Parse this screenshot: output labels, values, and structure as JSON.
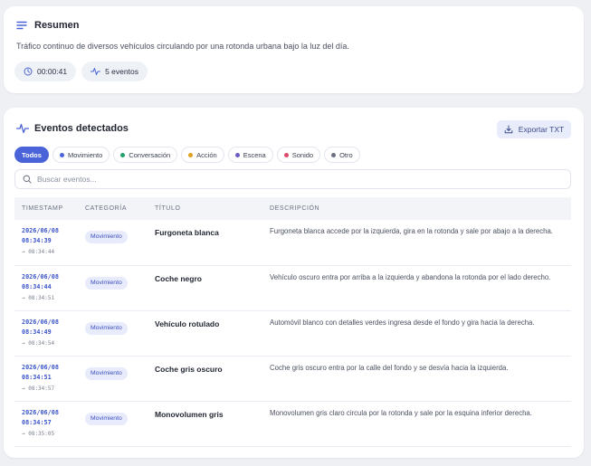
{
  "summary": {
    "title": "Resumen",
    "description": "Tráfico continuo de diversos vehículos circulando por una rotonda urbana bajo la luz del día.",
    "duration": "00:00:41",
    "events_count": "5 eventos"
  },
  "events": {
    "title": "Eventos detectados",
    "export_label": "Exportar TXT",
    "search_placeholder": "Buscar eventos...",
    "filters": [
      {
        "label": "Todos",
        "active": true,
        "color": ""
      },
      {
        "label": "Movimiento",
        "active": false,
        "color": "#4a63d8"
      },
      {
        "label": "Conversación",
        "active": false,
        "color": "#22a06b"
      },
      {
        "label": "Acción",
        "active": false,
        "color": "#e0a020"
      },
      {
        "label": "Escena",
        "active": false,
        "color": "#6a5cc8"
      },
      {
        "label": "Sonido",
        "active": false,
        "color": "#e0486a"
      },
      {
        "label": "Otro",
        "active": false,
        "color": "#6a7080"
      }
    ],
    "columns": [
      "TIMESTAMP",
      "CATEGORÍA",
      "TÍTULO",
      "DESCRIPCIÓN"
    ],
    "rows": [
      {
        "date": "2026/06/08",
        "time": "08:34:39",
        "end": "→ 08:34:44",
        "category": "Movimiento",
        "title": "Furgoneta blanca",
        "description": "Furgoneta blanca accede por la izquierda, gira en la rotonda y sale por abajo a la derecha."
      },
      {
        "date": "2026/06/08",
        "time": "08:34:44",
        "end": "→ 08:34:51",
        "category": "Movimiento",
        "title": "Coche negro",
        "description": "Vehículo oscuro entra por arriba a la izquierda y abandona la rotonda por el lado derecho."
      },
      {
        "date": "2026/06/08",
        "time": "08:34:49",
        "end": "→ 08:34:54",
        "category": "Movimiento",
        "title": "Vehículo rotulado",
        "description": "Automóvil blanco con detalles verdes ingresa desde el fondo y gira hacia la derecha."
      },
      {
        "date": "2026/06/08",
        "time": "08:34:51",
        "end": "→ 08:34:57",
        "category": "Movimiento",
        "title": "Coche gris oscuro",
        "description": "Coche gris oscuro entra por la calle del fondo y se desvía hacia la izquierda."
      },
      {
        "date": "2026/06/08",
        "time": "08:34:57",
        "end": "→ 08:35:05",
        "category": "Movimiento",
        "title": "Monovolumen gris",
        "description": "Monovolumen gris claro circula por la rotonda y sale por la esquina inferior derecha."
      }
    ]
  },
  "colors": {
    "accent": "#4a63d8",
    "badge_bg": "#e8ebfb",
    "page_bg": "#eef0f4"
  }
}
